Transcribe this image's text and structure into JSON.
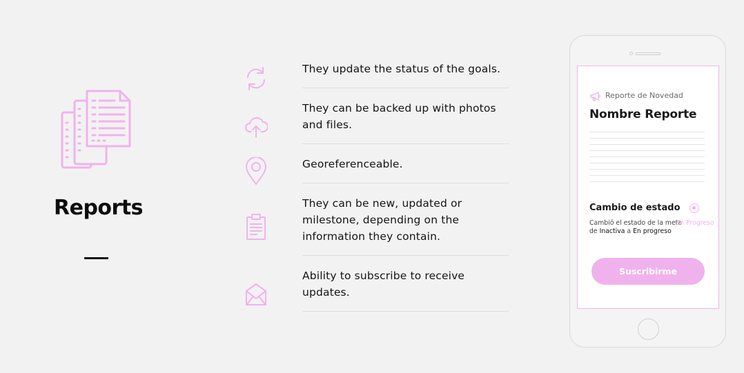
{
  "colors": {
    "accent": "#f0b2ec",
    "background": "#f2f2f2",
    "text": "#111111",
    "divider": "#dedede"
  },
  "hero": {
    "icon": "documents-icon",
    "title": "Reports"
  },
  "features": [
    {
      "icon": "refresh-icon",
      "text": "They update the status of the goals."
    },
    {
      "icon": "cloud-upload-icon",
      "text": "They can be backed up with photos and files."
    },
    {
      "icon": "location-pin-icon",
      "text": "Georeferenceable."
    },
    {
      "icon": "clipboard-icon",
      "text": "They can be new, updated or milestone, depending on the information they contain."
    },
    {
      "icon": "envelope-icon",
      "text": "Ability to subscribe to receive updates."
    }
  ],
  "phone": {
    "kicker_icon": "megaphone-icon",
    "kicker": "Reporte de Novedad",
    "report_title": "Nombre Reporte",
    "status_title": "Cambio de estado",
    "status_desc_prefix": "Cambió el estado de la meta de ",
    "status_from": "Inactiva",
    "status_mid": " a ",
    "status_to": "En progreso",
    "status_badge": "En Progreso",
    "subscribe_label": "Suscribirme"
  }
}
